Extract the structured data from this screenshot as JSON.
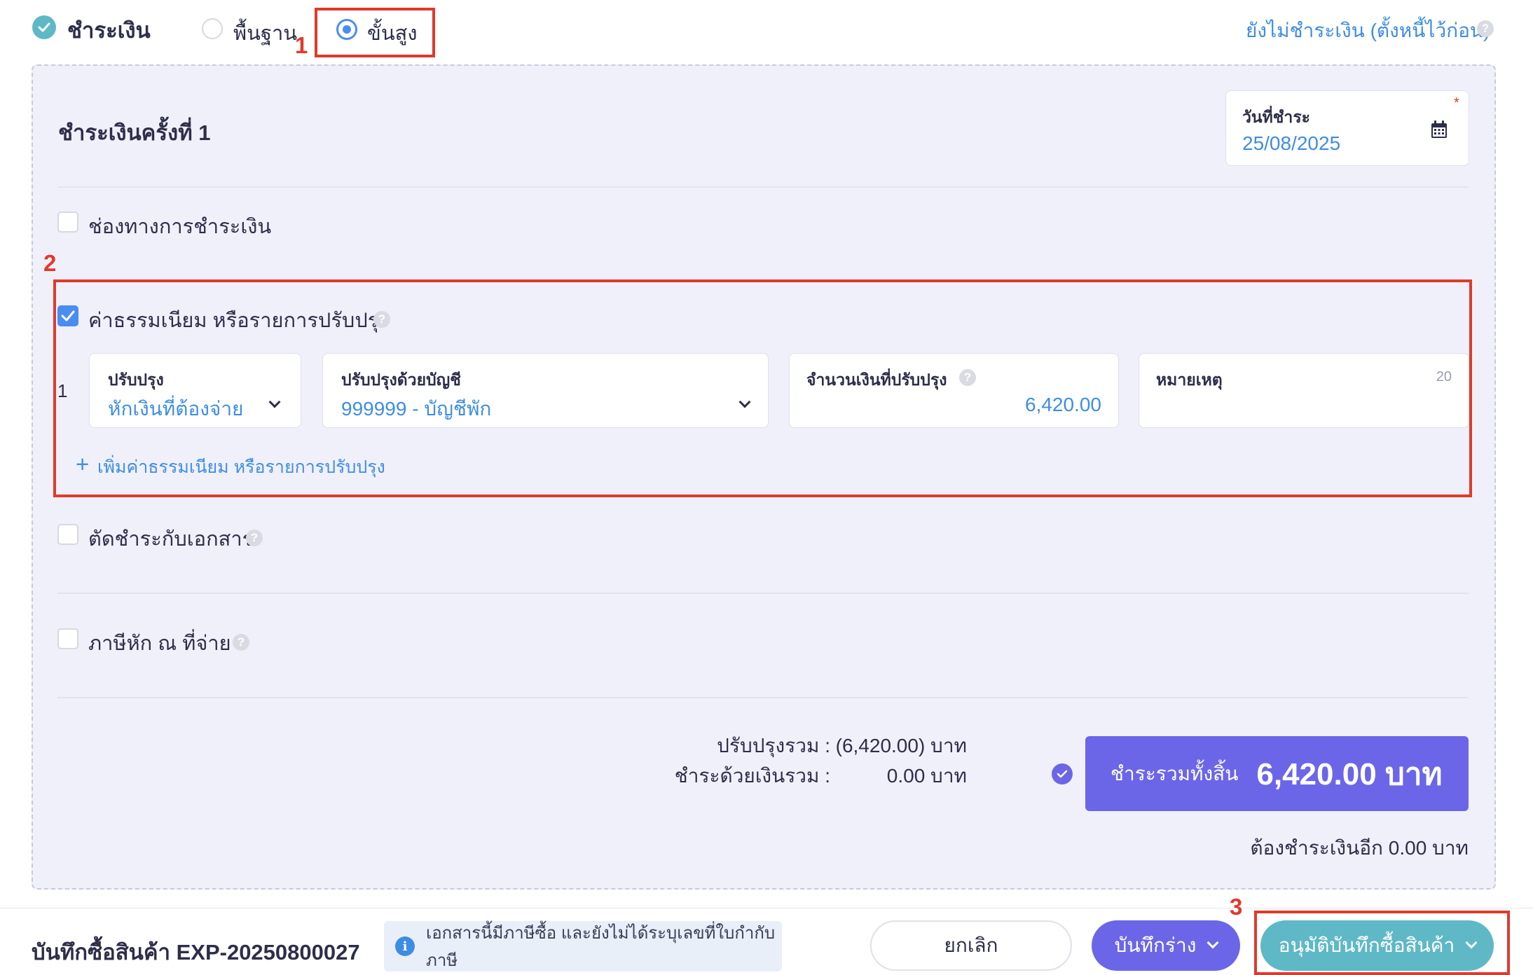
{
  "header": {
    "title": "ชำระเงิน",
    "mode_basic": "พื้นฐาน",
    "mode_advanced": "ขั้นสูง",
    "mode_selected": "ขั้นสูง",
    "unpaid_link": "ยังไม่ชำระเงิน (ตั้งหนี้ไว้ก่อน)"
  },
  "markers": {
    "m1": "1",
    "m2": "2",
    "m3": "3"
  },
  "payment": {
    "section_title": "ชำระเงินครั้งที่ 1",
    "date_label": "วันที่ชำระ",
    "date_required": "*",
    "date_value": "25/08/2025"
  },
  "options": {
    "channel": {
      "label": "ช่องทางการชำระเงิน",
      "checked": false
    },
    "fees": {
      "label": "ค่าธรรมเนียม หรือรายการปรับปรุง",
      "checked": true
    },
    "offset": {
      "label": "ตัดชำระกับเอกสาร",
      "checked": false
    },
    "wht": {
      "label": "ภาษีหัก ณ ที่จ่าย",
      "checked": false
    }
  },
  "adjustment": {
    "row_number": "1",
    "type_label": "ปรับปรุง",
    "type_value": "หักเงินที่ต้องจ่าย",
    "account_label": "ปรับปรุงด้วยบัญชี",
    "account_value": "999999 - บัญชีพัก",
    "amount_label": "จำนวนเงินที่ปรับปรุง",
    "amount_value": "6,420.00",
    "note_label": "หมายเหตุ",
    "note_counter": "20",
    "add_label": "เพิ่มค่าธรรมเนียม หรือรายการปรับปรุง"
  },
  "summary": {
    "adjust_total_label": "ปรับปรุงรวม :",
    "adjust_total_value": "(6,420.00) บาท",
    "cash_total_label": "ชำระด้วยเงินรวม :",
    "cash_total_value": "0.00 บาท",
    "grand_label": "ชำระรวมทั้งสิ้น",
    "grand_value": "6,420.00 บาท",
    "remaining": "ต้องชำระเงินอีก 0.00 บาท"
  },
  "footer": {
    "doc_title": "บันทึกซื้อสินค้า EXP-20250800027",
    "notice": "เอกสารนี้มีภาษีซื้อ และยังไม่ได้ระบุเลขที่ใบกำกับภาษี",
    "cancel": "ยกเลิก",
    "draft": "บันทึกร่าง",
    "approve": "อนุมัติบันทึกซื้อสินค้า"
  },
  "colors": {
    "accent_blue": "#4a8df2",
    "purple": "#6b66e8",
    "teal": "#5fb8c6",
    "annotation_red": "#e03a2c"
  }
}
